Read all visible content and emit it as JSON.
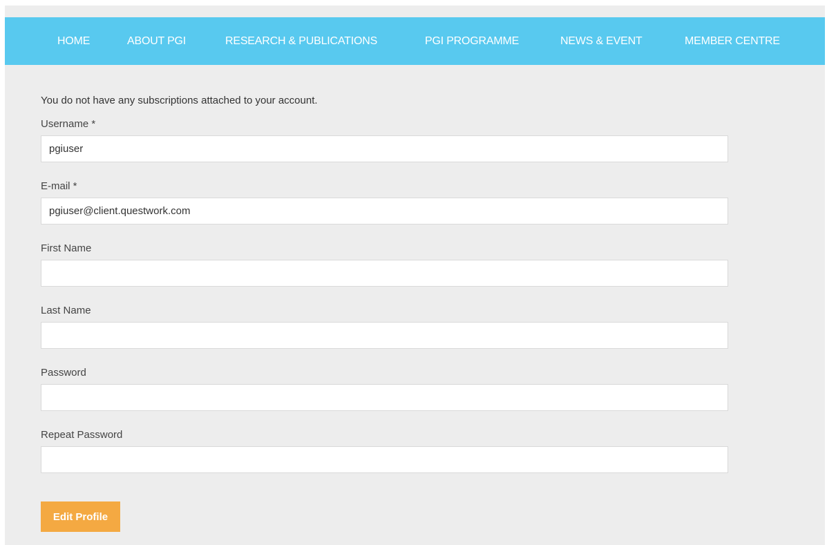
{
  "nav": {
    "items": [
      {
        "label": "HOME"
      },
      {
        "label": "ABOUT PGI"
      },
      {
        "label": "RESEARCH & PUBLICATIONS"
      },
      {
        "label": "PGI PROGRAMME"
      },
      {
        "label": "NEWS & EVENT"
      },
      {
        "label": "MEMBER CENTRE"
      }
    ]
  },
  "notice": "You do not have any subscriptions attached to your account.",
  "form": {
    "username": {
      "label": "Username *",
      "value": "pgiuser"
    },
    "email": {
      "label": "E-mail *",
      "value": "pgiuser@client.questwork.com"
    },
    "first_name": {
      "label": "First Name",
      "value": ""
    },
    "last_name": {
      "label": "Last Name",
      "value": ""
    },
    "password": {
      "label": "Password",
      "value": ""
    },
    "repeat_password": {
      "label": "Repeat Password",
      "value": ""
    },
    "submit_label": "Edit Profile"
  },
  "colors": {
    "nav_background": "#58c9ef",
    "page_background": "#ededed",
    "button_background": "#f4a942"
  }
}
